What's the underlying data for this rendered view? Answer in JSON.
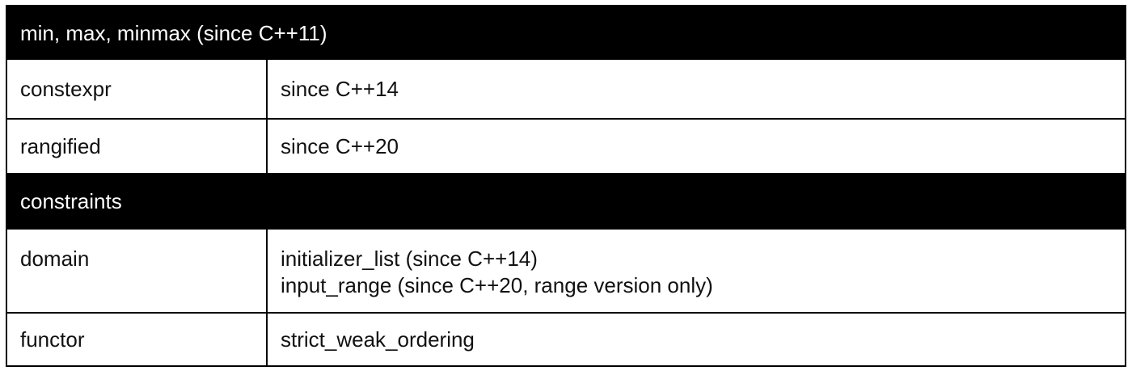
{
  "sections": [
    {
      "title": "min, max, minmax (since C++11)",
      "rows": [
        {
          "key": "constexpr",
          "values": [
            "since C++14"
          ]
        },
        {
          "key": "rangified",
          "values": [
            "since C++20"
          ]
        }
      ]
    },
    {
      "title": "constraints",
      "rows": [
        {
          "key": "domain",
          "values": [
            "initializer_list (since C++14)",
            "input_range (since C++20, range version only)"
          ]
        },
        {
          "key": "functor",
          "values": [
            "strict_weak_ordering"
          ]
        }
      ]
    }
  ]
}
